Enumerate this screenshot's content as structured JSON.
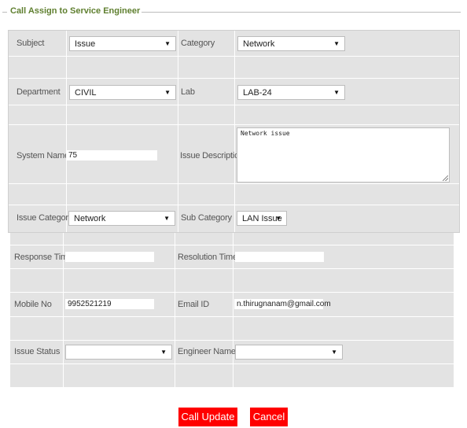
{
  "legend": "Call Assign to Service Engineer",
  "form": {
    "subject": {
      "label": "Subject",
      "value": "Issue"
    },
    "category": {
      "label": "Category",
      "value": "Network"
    },
    "department": {
      "label": "Department",
      "value": "CIVIL"
    },
    "lab": {
      "label": "Lab",
      "value": "LAB-24"
    },
    "system_name": {
      "label": "System Name",
      "value": "75"
    },
    "issue_description": {
      "label": "Issue Description",
      "value": "Network issue"
    },
    "issue_category": {
      "label": "Issue Category",
      "value": "Network"
    },
    "sub_category": {
      "label": "Sub Category",
      "value": "LAN Issue"
    },
    "response_time": {
      "label": "Response Time",
      "value": ""
    },
    "resolution_time": {
      "label": "Resolution Time",
      "value": ""
    },
    "mobile_no": {
      "label": "Mobile No",
      "value": "9952521219"
    },
    "email_id": {
      "label": "Email ID",
      "value": "n.thirugnanam@gmail.com"
    },
    "issue_status": {
      "label": "Issue Status",
      "value": ""
    },
    "engineer_name": {
      "label": "Engineer Name",
      "value": ""
    }
  },
  "buttons": {
    "update": "Call Update",
    "cancel": "Cancel"
  }
}
